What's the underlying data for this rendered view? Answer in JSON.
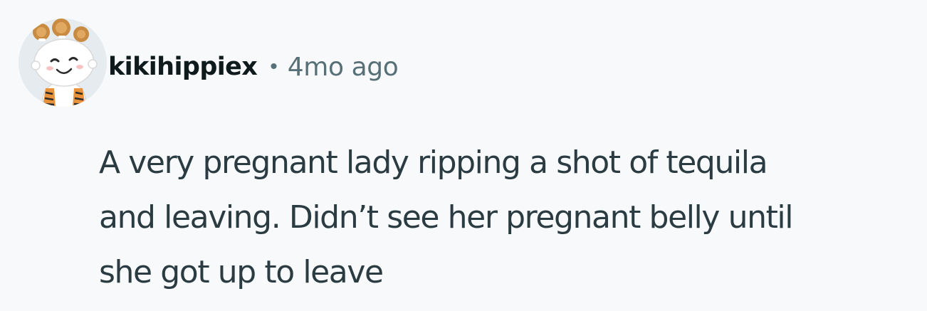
{
  "comment": {
    "author": {
      "username": "kikihippiex",
      "avatar_icon": "snoo-tiger-costume-avatar"
    },
    "separator": "•",
    "timestamp": "4mo ago",
    "body": "A very pregnant lady ripping a shot of tequila\nand leaving. Didn’t see her pregnant belly until\nshe got up to leave"
  },
  "colors": {
    "background": "#f8f9fa",
    "username": "#0f1a1c",
    "meta": "#576f76",
    "body_text": "#2a3c42",
    "avatar_background": "#e5ebee",
    "costume_orange": "#e8923a"
  }
}
